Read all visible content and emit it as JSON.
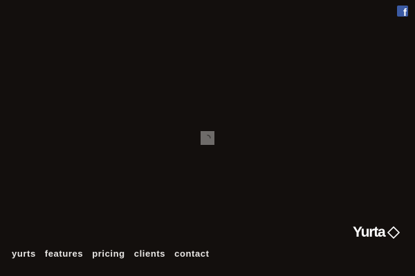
{
  "header": {
    "social": {
      "icon": "facebook-icon",
      "glyph": "f",
      "color": "#3b5aa3"
    }
  },
  "main": {
    "loader": {
      "icon": "loading-spinner-icon"
    }
  },
  "brand": {
    "name": "Yurta",
    "mark_icon": "diamond-icon"
  },
  "nav": {
    "items": [
      {
        "label": "yurts"
      },
      {
        "label": "features"
      },
      {
        "label": "pricing"
      },
      {
        "label": "clients"
      },
      {
        "label": "contact"
      }
    ]
  },
  "colors": {
    "background": "#130f0d",
    "text": "#e8e6e4",
    "loader": "#6e6b69"
  }
}
